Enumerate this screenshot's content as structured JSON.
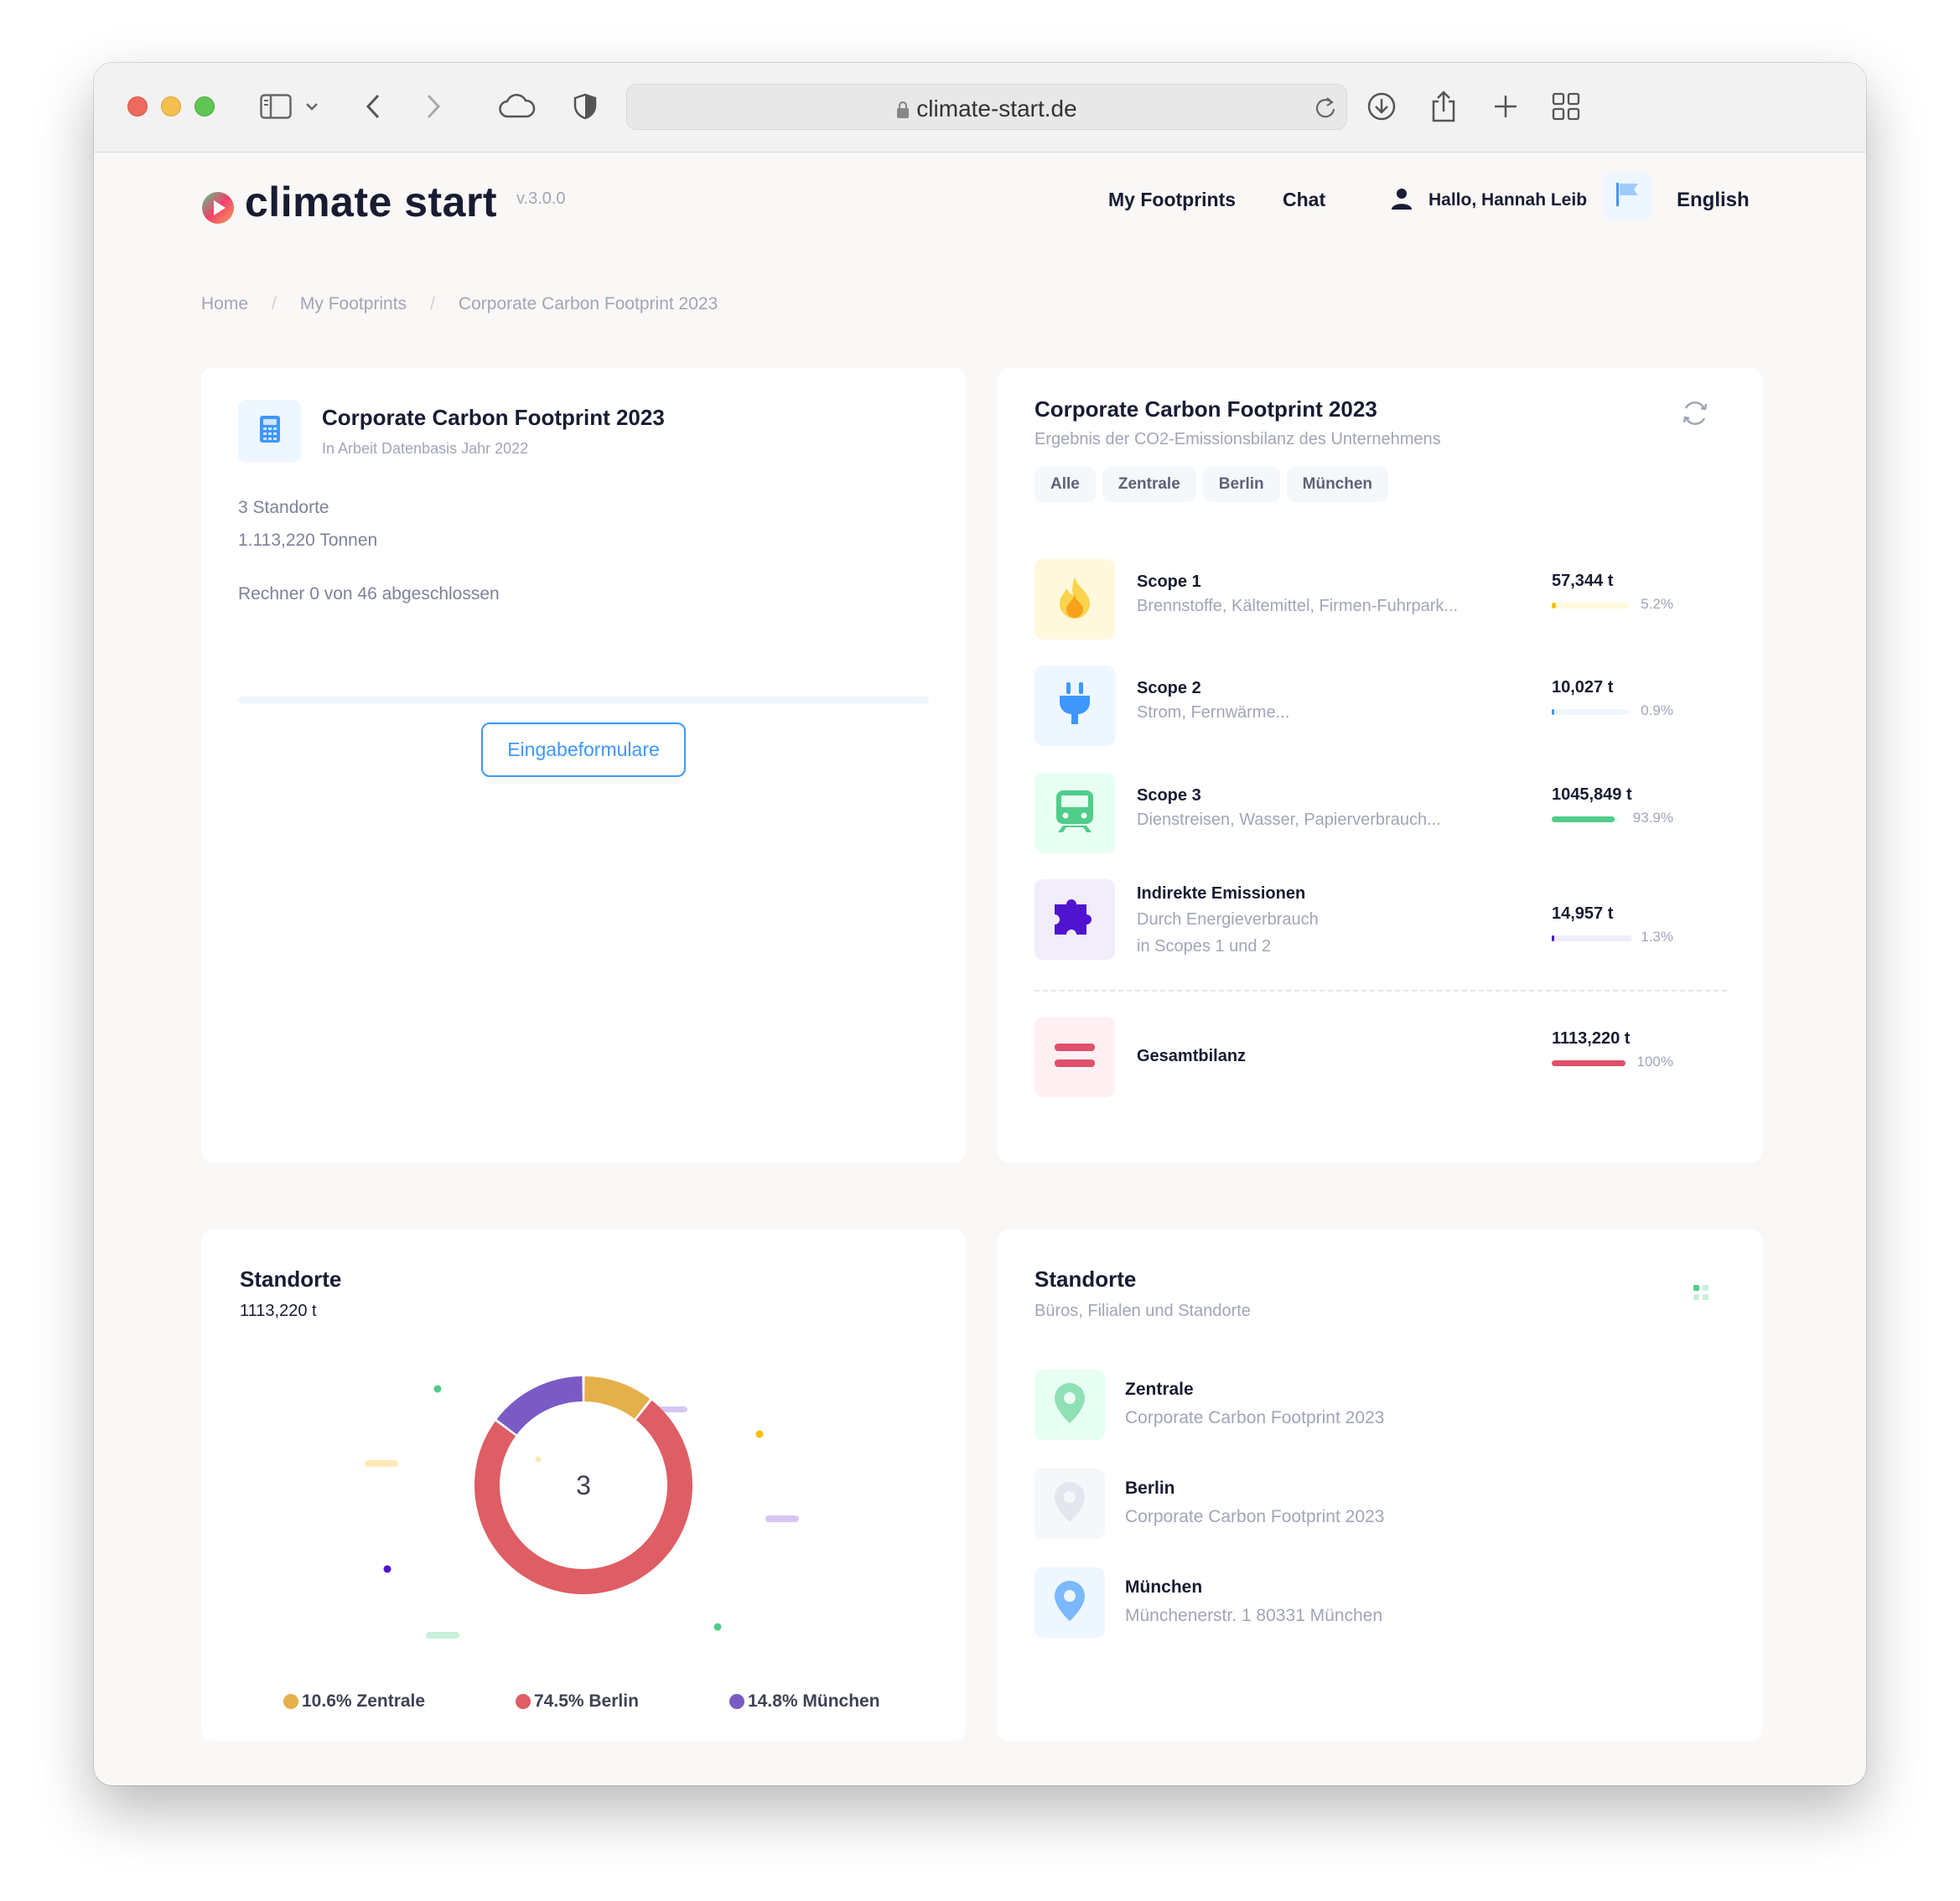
{
  "browser": {
    "url": "climate-start.de"
  },
  "app": {
    "logo_text": "climate start",
    "version": "v.3.0.0",
    "nav_footprints": "My Footprints",
    "nav_chat": "Chat",
    "user_greeting": "Hallo, Hannah Leib",
    "language": "English"
  },
  "breadcrumb": [
    "Home",
    "My Footprints",
    "Corporate Carbon Footprint 2023"
  ],
  "project_card": {
    "title": "Corporate Carbon Footprint 2023",
    "subtitle": "In Arbeit Datenbasis Jahr 2022",
    "locations": "3 Standorte",
    "tonnes": "1.113,220 Tonnen",
    "progress_text": "Rechner 0 von 46 abgeschlossen",
    "progress": 0,
    "button": "Eingabeformulare"
  },
  "result_card": {
    "title": "Corporate Carbon Footprint 2023",
    "subtitle": "Ergebnis der CO2-Emissionsbilanz des Unternehmens",
    "filters": [
      "Alle",
      "Zentrale",
      "Berlin",
      "München"
    ],
    "scopes": [
      {
        "name": "Scope 1",
        "desc": "Brennstoffe, Kältemittel, Firmen-Fuhrpark...",
        "value": "57,344 t",
        "pct": "5.2%",
        "fraction": 0.052,
        "color": "#f6c000",
        "track": "#fff8dd"
      },
      {
        "name": "Scope 2",
        "desc": "Strom, Fernwärme...",
        "value": "10,027 t",
        "pct": "0.9%",
        "fraction": 0.009,
        "color": "#3e97ff",
        "track": "#eef6ff"
      },
      {
        "name": "Scope 3",
        "desc": "Dienstreisen, Wasser, Papierverbrauch...",
        "value": "1045,849 t",
        "pct": "93.9%",
        "fraction": 0.939,
        "color": "#50cd89",
        "track": "#e8fff3"
      },
      {
        "name": "Indirekte Emissionen",
        "desc1": "Durch Energieverbrauch",
        "desc2": "in Scopes 1 und 2",
        "value": "14,957 t",
        "pct": "1.3%",
        "fraction": 0.013,
        "color": "#5014d0",
        "track": "#f1edfb"
      }
    ],
    "total": {
      "name": "Gesamtbilanz",
      "value": "1113,220 t",
      "pct": "100%",
      "fraction": 1.0,
      "color": "#e0506a"
    }
  },
  "sites_chart_card": {
    "title": "Standorte",
    "total": "1113,220 t",
    "center_label": "3",
    "legend": [
      {
        "label": "10.6% Zentrale",
        "color": "#e4b04a"
      },
      {
        "label": "74.5% Berlin",
        "color": "#df5d64"
      },
      {
        "label": "14.8% München",
        "color": "#7a5bc4"
      }
    ]
  },
  "chart_data": {
    "type": "pie",
    "categories": [
      "Zentrale",
      "Berlin",
      "München"
    ],
    "values": [
      10.6,
      74.5,
      14.8
    ],
    "colors": [
      "#e4b04a",
      "#df5d64",
      "#7a5bc4"
    ],
    "title": "Standorte"
  },
  "sites_list_card": {
    "title": "Standorte",
    "subtitle": "Büros, Filialen und Standorte",
    "items": [
      {
        "name": "Zentrale",
        "desc": "Corporate Carbon Footprint 2023",
        "color": "#50cd89",
        "bg": "#e8fff3"
      },
      {
        "name": "Berlin",
        "desc": "Corporate Carbon Footprint 2023",
        "color": "#e4e6ef",
        "bg": "#f5f8fa"
      },
      {
        "name": "München",
        "desc": "Münchenerstr. 1 80331 München",
        "color": "#7ab8ff",
        "bg": "#eef6ff"
      }
    ]
  }
}
